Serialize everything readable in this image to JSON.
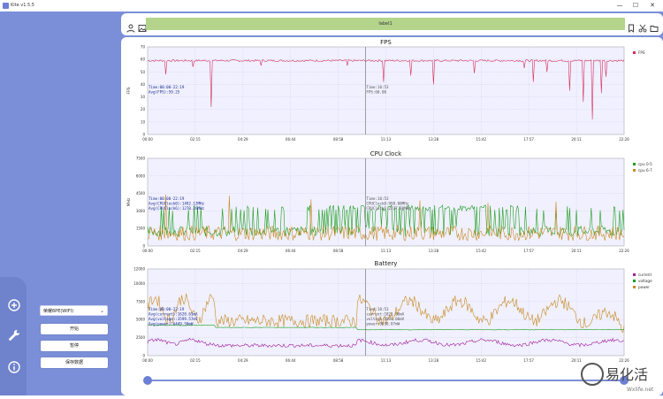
{
  "window": {
    "title": "Kite v1.5.5",
    "min": "—",
    "max": "☐",
    "close": "✕"
  },
  "toolbar": {
    "label": "label1"
  },
  "sidebar": {
    "device": "荣耀6PE(WIFI)",
    "start": "开始",
    "pause": "暂停",
    "save": "保存数据"
  },
  "time_ticks": [
    "00:00",
    "02:15",
    "04:29",
    "06:44",
    "08:58",
    "11:13",
    "13:28",
    "15:42",
    "17:57",
    "20:11",
    "22:26"
  ],
  "charts": {
    "fps": {
      "title": "FPS",
      "ylabel": "FPS",
      "yticks": [
        "0",
        "10",
        "20",
        "30",
        "40",
        "50",
        "60",
        "70"
      ],
      "ymax": 70,
      "legend": [
        {
          "name": "FPS",
          "color": "#d62f5a"
        }
      ],
      "info_left": [
        "Time:00:00-22:19",
        "Avg(FPS):59.25"
      ],
      "info_mid": [
        "Time:10:53",
        "FPS:60.00"
      ],
      "series": [
        {
          "name": "FPS",
          "color": "#d62f5a",
          "base": 59,
          "noise": 1.5,
          "dips": [
            [
              4,
              48
            ],
            [
              10,
              54
            ],
            [
              14,
              22
            ],
            [
              25,
              55
            ],
            [
              44,
              55
            ],
            [
              52,
              42
            ],
            [
              58,
              47
            ],
            [
              63,
              40
            ],
            [
              72,
              49
            ],
            [
              83,
              53
            ],
            [
              85,
              42
            ],
            [
              88,
              50
            ],
            [
              93,
              35
            ],
            [
              96,
              26
            ],
            [
              98,
              12
            ],
            [
              100,
              33
            ],
            [
              101,
              46
            ]
          ]
        }
      ]
    },
    "cpu": {
      "title": "CPU Clock",
      "ylabel": "MHz",
      "yticks": [
        "0",
        "1500",
        "3000",
        "4500",
        "6000",
        "7500"
      ],
      "ymax": 7500,
      "legend": [
        {
          "name": "cpu 0-5",
          "color": "#1a9e1a"
        },
        {
          "name": "cpu 6-7",
          "color": "#c98a1e"
        }
      ],
      "info_left": [
        "Time:00:00-22:19",
        "Avg(CPUClock0):1492.12MHz",
        "Avg(CPUClock6):1270.26MHz"
      ],
      "info_mid": [
        "Time:10:53",
        "CPUClock0:998.00MHz",
        "CPUClock6:2227.00MHz"
      ],
      "series": [
        {
          "name": "cpu 0-5",
          "color": "#1a9e1a",
          "base": 1300,
          "noise": 1700,
          "dips": []
        },
        {
          "name": "cpu 6-7",
          "color": "#c98a1e",
          "base": 1100,
          "noise": 1300,
          "dips": [
            [
              4,
              4400
            ],
            [
              18,
              4300
            ],
            [
              36,
              4000
            ],
            [
              60,
              3900
            ],
            [
              75,
              3700
            ],
            [
              90,
              3800
            ]
          ]
        }
      ]
    },
    "battery": {
      "title": "Battery",
      "ylabel": "",
      "yticks": [
        "0",
        "2500",
        "5000",
        "7500",
        "10000",
        "12000"
      ],
      "ymax": 12000,
      "legend": [
        {
          "name": "current",
          "color": "#a01a9a"
        },
        {
          "name": "voltage",
          "color": "#1aa01a"
        },
        {
          "name": "power",
          "color": "#c98a1e"
        }
      ],
      "info_left": [
        "Time:00:00-22:19",
        "Avg(current):1620.61mA",
        "Avg(voltage):3599.57mV",
        "Avg(power):6449.50mW"
      ],
      "info_mid": [
        "Time:10:53",
        "current:1821.00mA",
        "voltage:3894.00mV",
        "power:9930.07mW"
      ],
      "series": [
        {
          "name": "power",
          "color": "#c98a1e",
          "base": 5600,
          "noise": 1800,
          "dips": []
        },
        {
          "name": "voltage",
          "color": "#1aa01a",
          "base": 3600,
          "noise": 80,
          "dips": []
        },
        {
          "name": "current",
          "color": "#a01a9a",
          "base": 1600,
          "noise": 500,
          "dips": []
        }
      ]
    }
  },
  "watermark": {
    "text": "易化活",
    "url": "Wxlife.net"
  }
}
